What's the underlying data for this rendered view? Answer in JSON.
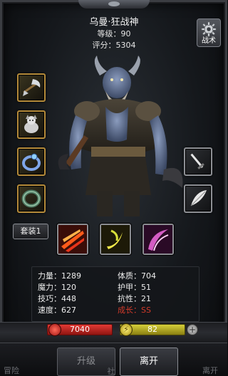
{
  "header": {
    "name": "乌曼·狂战神",
    "level": "等级：90",
    "score": "评分：5304"
  },
  "tactics_button": {
    "label": "战术",
    "icon": "gear-icon"
  },
  "equipment_left": [
    {
      "icon": "axe-weapon-icon"
    },
    {
      "icon": "pet-creature-icon"
    },
    {
      "icon": "blue-ring-icon"
    },
    {
      "icon": "green-bracelet-icon"
    }
  ],
  "equipment_right": [
    {
      "icon": "sword-icon"
    },
    {
      "icon": "feather-quill-icon"
    }
  ],
  "set_button": {
    "label": "套装1"
  },
  "skills": [
    {
      "icon": "fire-slash-skill-icon"
    },
    {
      "icon": "yellow-crescent-skill-icon"
    },
    {
      "icon": "pink-slash-skill-icon"
    }
  ],
  "stats": {
    "left": [
      "力量：1289",
      "魔力：120",
      "技巧：448",
      "速度：627"
    ],
    "right": [
      "体质：704",
      "护甲：51",
      "抗性：21",
      "成长：SS"
    ]
  },
  "hp": {
    "value": "7040"
  },
  "mp": {
    "value": "82",
    "icon_glyph": "⚡"
  },
  "plus_glyph": "+",
  "buttons": {
    "upgrade": "升级",
    "leave": "离开",
    "ghost_left": "冒险",
    "ghost_mid": "社",
    "ghost_right": "离开"
  },
  "colors": {
    "gold_border": "#b58b3a",
    "growth_red": "#d23a2a",
    "hp_red": "#e23a35",
    "mp_yellow": "#d6cf3a"
  }
}
